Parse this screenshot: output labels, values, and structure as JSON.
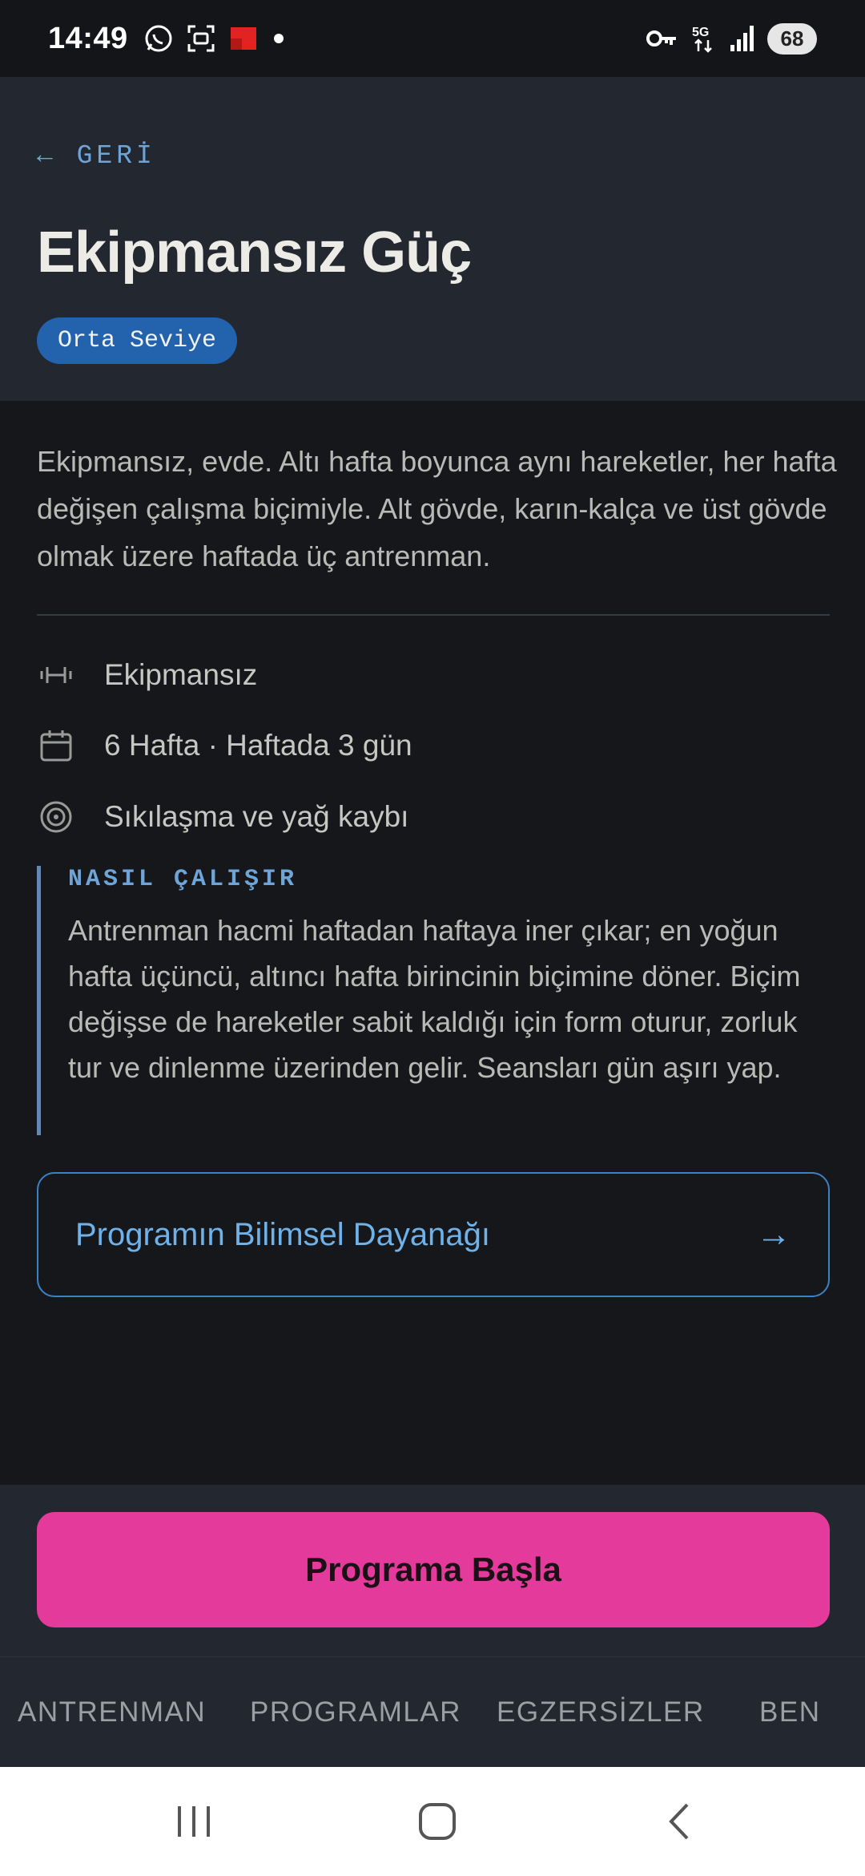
{
  "status_bar": {
    "time": "14:49",
    "battery": "68",
    "left_icons": [
      "whatsapp-icon",
      "screenshot-icon",
      "flag-icon",
      "dot-icon"
    ],
    "right_icons": [
      "key-icon",
      "5g-icon",
      "signal-icon"
    ]
  },
  "header": {
    "back_label": "← GERİ",
    "title": "Ekipmansız Güç",
    "level": "Orta Seviye"
  },
  "description": "Ekipmansız, evde. Altı hafta boyunca aynı hareketler, her hafta değişen çalışma biçimiyle. Alt gövde, karın-kalça ve üst gövde olmak üzere haftada üç antrenman.",
  "info": [
    {
      "icon": "dumbbell-icon",
      "text": "Ekipmansız"
    },
    {
      "icon": "calendar-icon",
      "text": "6 Hafta · Haftada 3 gün"
    },
    {
      "icon": "target-icon",
      "text": "Sıkılaşma ve yağ kaybı"
    }
  ],
  "how_it_works": {
    "title": "NASIL ÇALIŞIR",
    "text": "Antrenman hacmi haftadan haftaya iner çıkar; en yoğun hafta üçüncü, altıncı hafta birincinin biçimine döner. Biçim değişse de hareketler sabit kaldığı için form oturur, zorluk tur ve dinlenme üzerinden gelir. Seansları gün aşırı yap."
  },
  "science_link": {
    "label": "Programın Bilimsel Dayanağı",
    "arrow": "→"
  },
  "cta": {
    "label": "Programa Başla",
    "color": "#e33a9b"
  },
  "bottom_nav": [
    "ANTRENMAN",
    "PROGRAMLAR",
    "EGZERSİZLER",
    "BEN"
  ],
  "colors": {
    "accent_blue": "#6fa4d8",
    "badge_blue": "#2363ad",
    "background": "#15171b",
    "panel": "#23272f"
  }
}
